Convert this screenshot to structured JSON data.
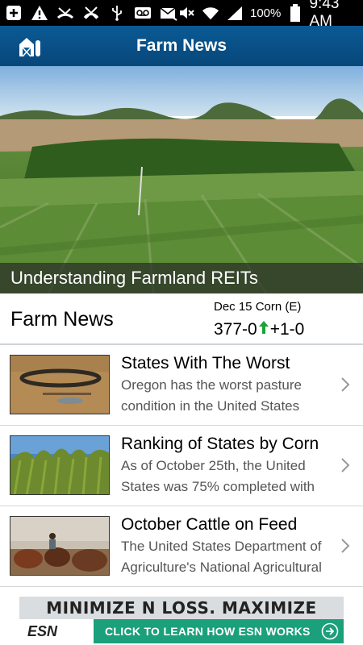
{
  "status_bar": {
    "battery_percent": "100%",
    "time": "9:43 AM",
    "icons": [
      "add-icon",
      "warning-icon",
      "missed-call-icon",
      "no-signal-icon",
      "usb-icon",
      "voicemail-icon",
      "mail-icon",
      "mute-icon",
      "wifi-icon",
      "signal-icon",
      "battery-icon"
    ]
  },
  "app_bar": {
    "title": "Farm News",
    "icon": "barn-icon"
  },
  "hero": {
    "caption": "Understanding Farmland REITs"
  },
  "ticker": {
    "section_title": "Farm News",
    "contract": "Dec 15 Corn (E)",
    "price": "377-0",
    "change": "+1-0",
    "direction": "up",
    "up_color": "#1aa33a"
  },
  "news_items": [
    {
      "title": "States With The Worst",
      "summary": "Oregon has the worst pasture condition in the United States"
    },
    {
      "title": "Ranking of States by Corn",
      "summary": "As of October 25th, the United States was 75% completed with"
    },
    {
      "title": "October Cattle on Feed",
      "summary": "The United States Department of Agriculture's National Agricultural"
    }
  ],
  "ad": {
    "headline": "MINIMIZE N LOSS. MAXIMIZE YIELD.",
    "logo_text": "ESN",
    "cta": "CLICK TO LEARN HOW ESN WORKS",
    "accent": "#1aa07a"
  },
  "colors": {
    "app_bar": "#07477a",
    "divider": "#d6d6d6"
  }
}
